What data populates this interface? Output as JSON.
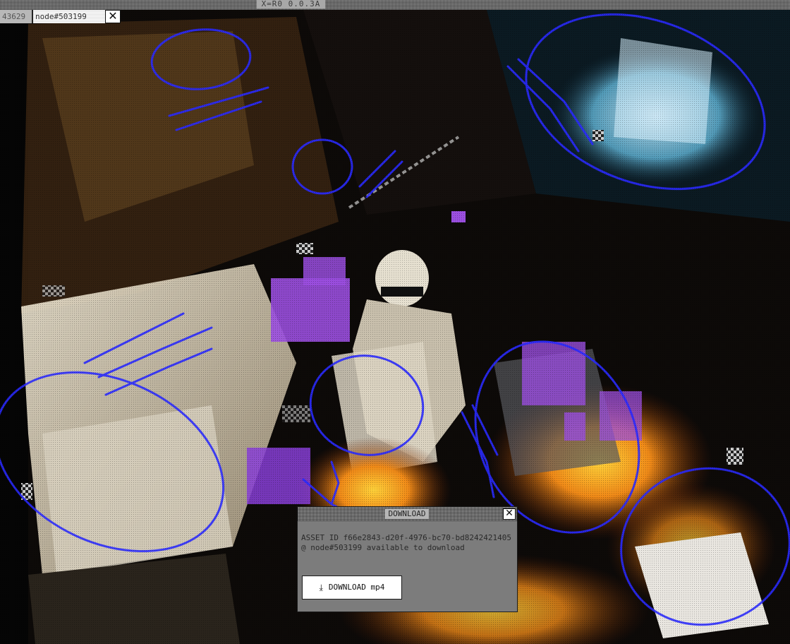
{
  "topbar": {
    "title": "X=R0 0.0.3A"
  },
  "tabs": [
    {
      "label": "43629"
    },
    {
      "label": "node#503199"
    }
  ],
  "tab_close_glyph": "✕",
  "dialog": {
    "title": "DOWNLOAD",
    "close_glyph": "✕",
    "message": "ASSET ID f66e2843-d20f-4976-bc70-bd8242421405 @ node#503199 available to download",
    "download_button": {
      "icon": "download-icon",
      "icon_glyph": "⤓",
      "label": "DOWNLOAD mp4"
    }
  },
  "colors": {
    "annotation_blue": "#2b2bff",
    "glitch_purple": "#9b4fe0",
    "fire_orange": "#e8841a"
  }
}
